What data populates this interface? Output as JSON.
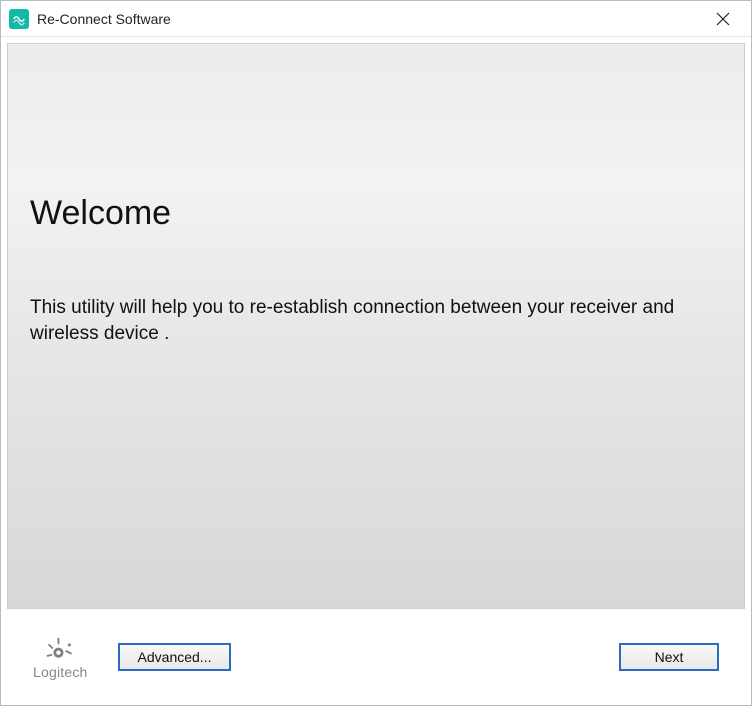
{
  "window": {
    "title": "Re-Connect Software"
  },
  "main": {
    "heading": "Welcome",
    "body": "This utility will help you to re-establish connection between your receiver and wireless device ."
  },
  "footer": {
    "brand": "Logitech",
    "advanced_label": "Advanced...",
    "next_label": "Next"
  }
}
